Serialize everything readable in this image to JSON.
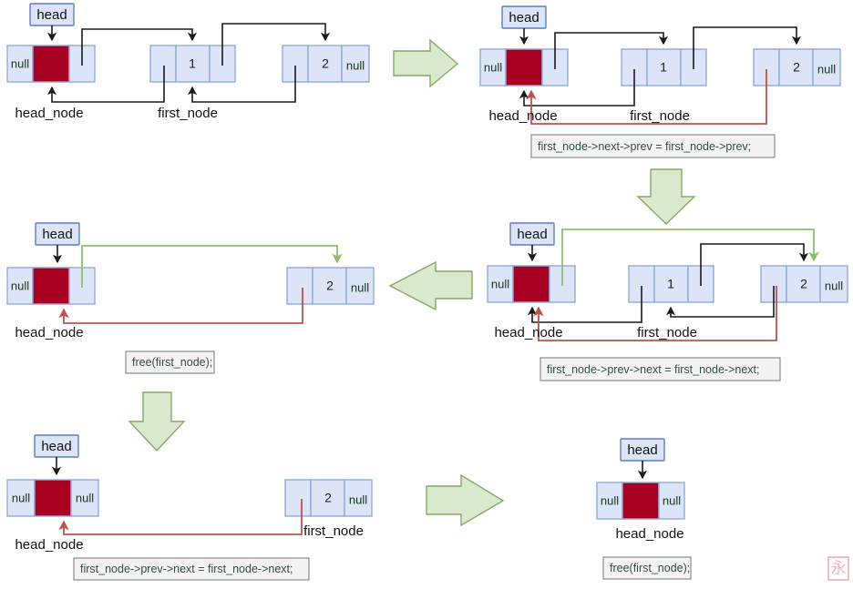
{
  "diagram": {
    "title": "Doubly linked list node deletion steps",
    "colors": {
      "node_fill": "#dbe5f7",
      "node_border": "#8faadc",
      "data_fill": "#a80021",
      "arrow_black": "#1a1a1a",
      "arrow_red": "#c0504d",
      "arrow_green": "#8cc06e",
      "big_arrow_fill": "#d9e9cd",
      "big_arrow_stroke": "#84ab63",
      "code_box_fill": "#f3f3f3",
      "code_box_stroke": "#8c8c8c",
      "watermark": "#f2b3bb"
    },
    "labels": {
      "head": "head",
      "null": "null",
      "head_node": "head_node",
      "first_node": "first_node",
      "value_1": "1",
      "value_2": "2"
    },
    "panels": [
      {
        "id": "panel-1",
        "position": "top-left",
        "nodes": [
          {
            "name": "head-node",
            "prev": "null",
            "data": "",
            "next": ""
          },
          {
            "name": "node-1",
            "prev": "",
            "data": "1",
            "next": ""
          },
          {
            "name": "node-2",
            "prev": "",
            "data": "2",
            "next": "null"
          }
        ],
        "pointer_labels": [
          "head",
          "head_node",
          "first_node"
        ],
        "code": null
      },
      {
        "id": "panel-2",
        "position": "top-right",
        "nodes": [
          {
            "name": "head-node",
            "prev": "null",
            "data": "",
            "next": ""
          },
          {
            "name": "node-1",
            "prev": "",
            "data": "1",
            "next": ""
          },
          {
            "name": "node-2",
            "prev": "",
            "data": "2",
            "next": "null"
          }
        ],
        "pointer_labels": [
          "head",
          "head_node",
          "first_node"
        ],
        "code": "first_node->next->prev = first_node->prev;"
      },
      {
        "id": "panel-3",
        "position": "middle-right",
        "nodes": [
          {
            "name": "head-node",
            "prev": "null",
            "data": "",
            "next": ""
          },
          {
            "name": "node-1",
            "prev": "",
            "data": "1",
            "next": ""
          },
          {
            "name": "node-2",
            "prev": "",
            "data": "2",
            "next": "null"
          }
        ],
        "pointer_labels": [
          "head",
          "head_node",
          "first_node"
        ],
        "code": "first_node->prev->next = first_node->next;"
      },
      {
        "id": "panel-4",
        "position": "middle-left",
        "nodes": [
          {
            "name": "head-node",
            "prev": "null",
            "data": "",
            "next": ""
          },
          {
            "name": "node-2",
            "prev": "",
            "data": "2",
            "next": "null"
          }
        ],
        "pointer_labels": [
          "head",
          "head_node"
        ],
        "code": "free(first_node);"
      },
      {
        "id": "panel-5",
        "position": "bottom-left",
        "nodes": [
          {
            "name": "head-node",
            "prev": "null",
            "data": "",
            "next": "null"
          },
          {
            "name": "node-2",
            "prev": "",
            "data": "2",
            "next": "null"
          }
        ],
        "pointer_labels": [
          "head",
          "head_node",
          "first_node"
        ],
        "code": "first_node->prev->next = first_node->next;"
      },
      {
        "id": "panel-6",
        "position": "bottom-right",
        "nodes": [
          {
            "name": "head-node",
            "prev": "null",
            "data": "",
            "next": "null"
          }
        ],
        "pointer_labels": [
          "head",
          "head_node"
        ],
        "code": "free(first_node);"
      }
    ],
    "flow_arrows": [
      {
        "name": "flow-arrow-right-top",
        "direction": "right"
      },
      {
        "name": "flow-arrow-down-right",
        "direction": "down"
      },
      {
        "name": "flow-arrow-left-middle",
        "direction": "left"
      },
      {
        "name": "flow-arrow-down-left",
        "direction": "down"
      },
      {
        "name": "flow-arrow-right-bottom",
        "direction": "right"
      }
    ],
    "watermark": "永"
  }
}
